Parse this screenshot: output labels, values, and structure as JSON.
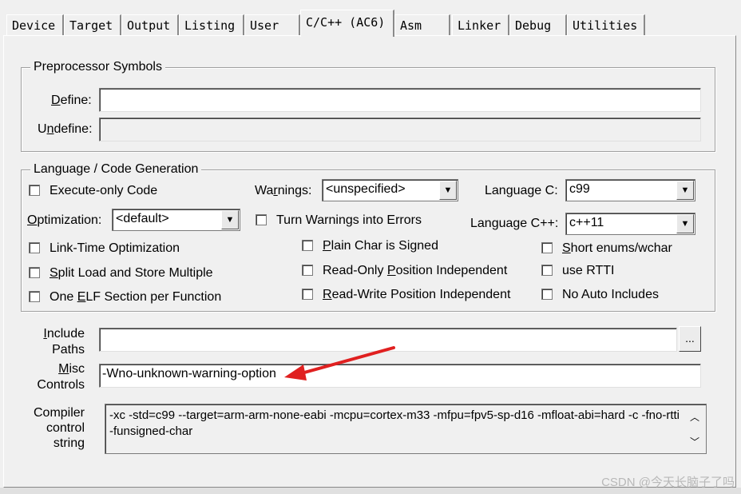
{
  "tabs": [
    {
      "label": "Device"
    },
    {
      "label": "Target"
    },
    {
      "label": "Output"
    },
    {
      "label": "Listing"
    },
    {
      "label": "User"
    },
    {
      "label": "C/C++ (AC6)"
    },
    {
      "label": "Asm"
    },
    {
      "label": "Linker"
    },
    {
      "label": "Debug"
    },
    {
      "label": "Utilities"
    }
  ],
  "active_tab": "C/C++ (AC6)",
  "preprocessor": {
    "title": "Preprocessor Symbols",
    "define_label_u": "D",
    "define_label_rest": "efine:",
    "define_value": "",
    "undefine_label_pre": "U",
    "undefine_label_u": "n",
    "undefine_label_rest": "define:",
    "undefine_value": ""
  },
  "language": {
    "title": "Language / Code Generation",
    "execute_only": "Execute-only Code",
    "warnings_label_pre": "Wa",
    "warnings_label_u": "r",
    "warnings_label_rest": "nings:",
    "warnings_value": "<unspecified>",
    "language_c_label": "Language C:",
    "language_c_value": "c99",
    "optimization_label_u": "O",
    "optimization_label_rest": "ptimization:",
    "optimization_value": "<default>",
    "turn_warnings": "Turn Warnings into Errors",
    "language_cpp_label": "Language C++:",
    "language_cpp_value": "c++11",
    "lto": "Link-Time Optimization",
    "plain_char_u": "P",
    "plain_char_rest": "lain Char is Signed",
    "short_enums_u": "S",
    "short_enums_rest": "hort enums/wchar",
    "split_load_u": "S",
    "split_load_rest": "plit Load and Store Multiple",
    "ropi_pre": "Read-Only ",
    "ropi_u": "P",
    "ropi_rest": "osition Independent",
    "rtti": "use RTTI",
    "one_elf_pre": "One ",
    "one_elf_u": "E",
    "one_elf_rest": "LF Section per Function",
    "rwpi_u": "R",
    "rwpi_rest": "ead-Write Position Independent",
    "no_auto_includes": "No Auto Includes"
  },
  "include_paths": {
    "label_line1_u": "I",
    "label_line1_rest": "nclude",
    "label_line2": "Paths",
    "value": "",
    "browse_label": "..."
  },
  "misc_controls": {
    "label_line1_u": "M",
    "label_line1_rest": "isc",
    "label_line2": "Controls",
    "value": "-Wno-unknown-warning-option"
  },
  "compiler_control": {
    "label_line1": "Compiler",
    "label_line2": "control",
    "label_line3": "string",
    "value": "-xc -std=c99 --target=arm-arm-none-eabi -mcpu=cortex-m33 -mfpu=fpv5-sp-d16 -mfloat-abi=hard -c -fno-rtti -funsigned-char"
  },
  "watermark": "CSDN @今天长脑子了吗",
  "colors": {
    "annotation_arrow": "#e02020"
  }
}
